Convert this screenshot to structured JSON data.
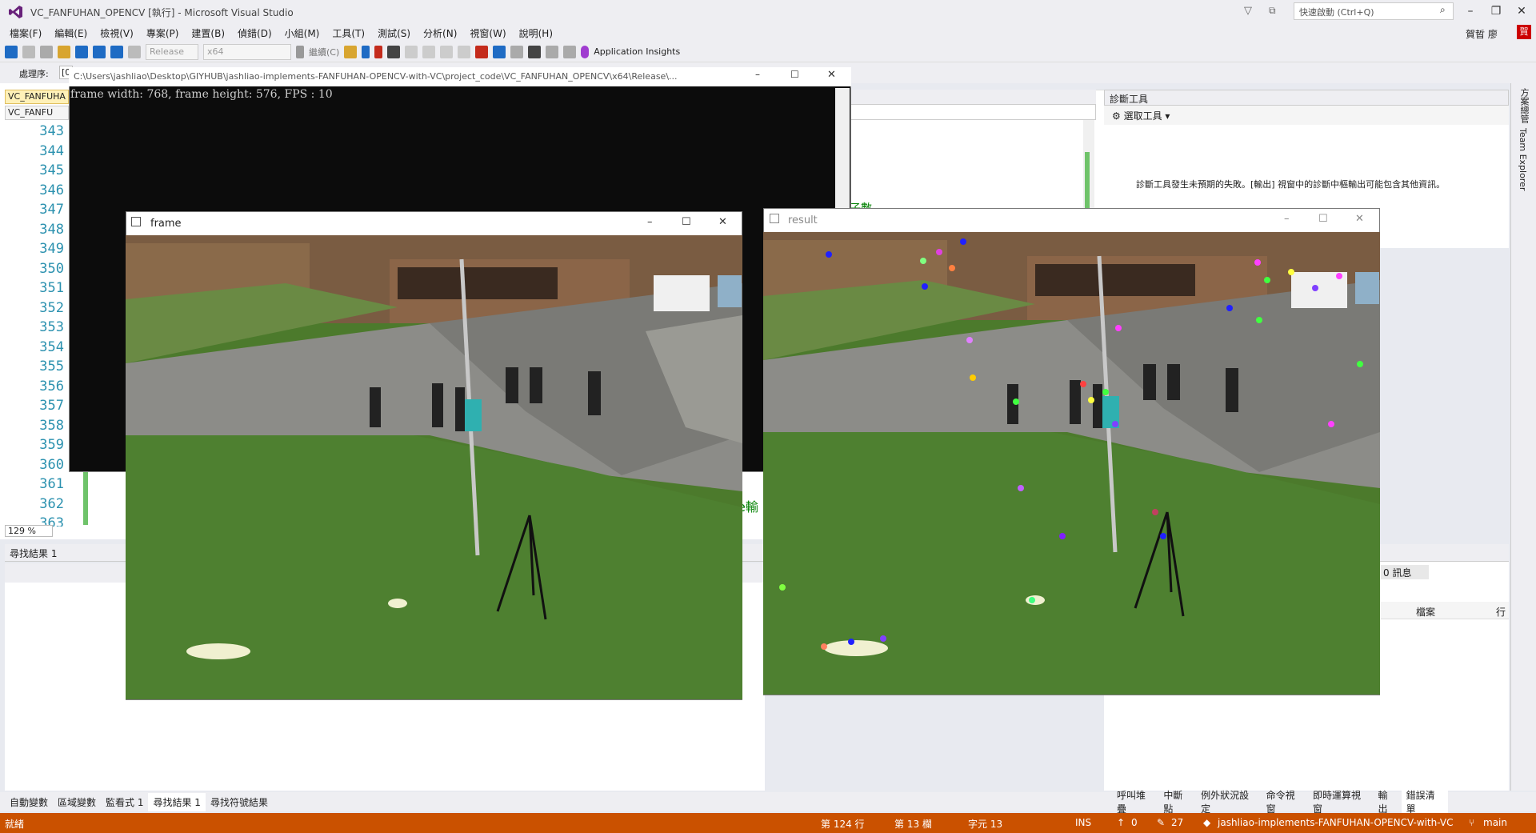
{
  "titlebar": {
    "title": "VC_FANFUHAN_OPENCV [執行] - Microsoft Visual Studio",
    "quick_launch": "快速啟動 (Ctrl+Q)",
    "user": "賀晢 廖",
    "user_badge": "賀"
  },
  "menu": [
    "檔案(F)",
    "編輯(E)",
    "檢視(V)",
    "專案(P)",
    "建置(B)",
    "偵錯(D)",
    "小組(M)",
    "工具(T)",
    "測試(S)",
    "分析(N)",
    "視窗(W)",
    "說明(H)"
  ],
  "toolbar": {
    "config": "Release",
    "platform": "x64",
    "continue": "繼續(C)",
    "insights": "Application Insights"
  },
  "row3": {
    "process_label": "處理序:",
    "process_value": "[0"
  },
  "editor": {
    "tab": "VC_FANFUHA",
    "tab2": "VC_FANFU",
    "line_numbers": [
      "343",
      "344",
      "345",
      "346",
      "347",
      "348",
      "349",
      "350",
      "351",
      "352",
      "353",
      "354",
      "355",
      "356",
      "357",
      "358",
      "359",
      "360",
      "361",
      "362",
      "363"
    ],
    "zoom": "129 %"
  },
  "console": {
    "path": "C:\\Users\\jashliao\\Desktop\\GIYHUB\\jashliao-implements-FANFUHAN-OPENCV-with-VC\\project_code\\VC_FANFUHAN_OPENCV\\x64\\Release\\...",
    "text": "frame width: 768, frame height: 576, FPS : 10"
  },
  "frame_window": {
    "title": "frame"
  },
  "result_window": {
    "title": "result"
  },
  "diag": {
    "title": "診斷工具",
    "tool": "選取工具",
    "message": "診斷工具發生未預期的失敗。[輸出] 視窗中的診斷中樞輸出可能包含其他資訊。"
  },
  "right_strip": [
    "方案總管",
    "Team Explorer"
  ],
  "find": {
    "title": "尋找結果 1"
  },
  "error_list": {
    "count": "0 訊息",
    "col_file": "檔案",
    "col_line": "行"
  },
  "bottom_tabs_left": [
    "自動變數",
    "區域變數",
    "監看式 1",
    "尋找結果 1",
    "尋找符號結果"
  ],
  "bottom_tabs_right": [
    "呼叫堆疊",
    "中斷點",
    "例外狀況設定",
    "命令視窗",
    "即時運算視窗",
    "輸出",
    "錯誤清單"
  ],
  "status": {
    "ready": "就緒",
    "line": "第 124 行",
    "col": "第 13 欄",
    "char": "字元 13",
    "ins": "INS",
    "up": "0",
    "edits": "27",
    "repo": "jashliao-implements-FANFUHAN-OPENCV-with-VC",
    "branch": "main"
  },
  "partial_text": {
    "fn": "子數",
    "out": "e輸"
  },
  "colors": {
    "status_bar": "#ca5100",
    "accent": "#68217a"
  }
}
